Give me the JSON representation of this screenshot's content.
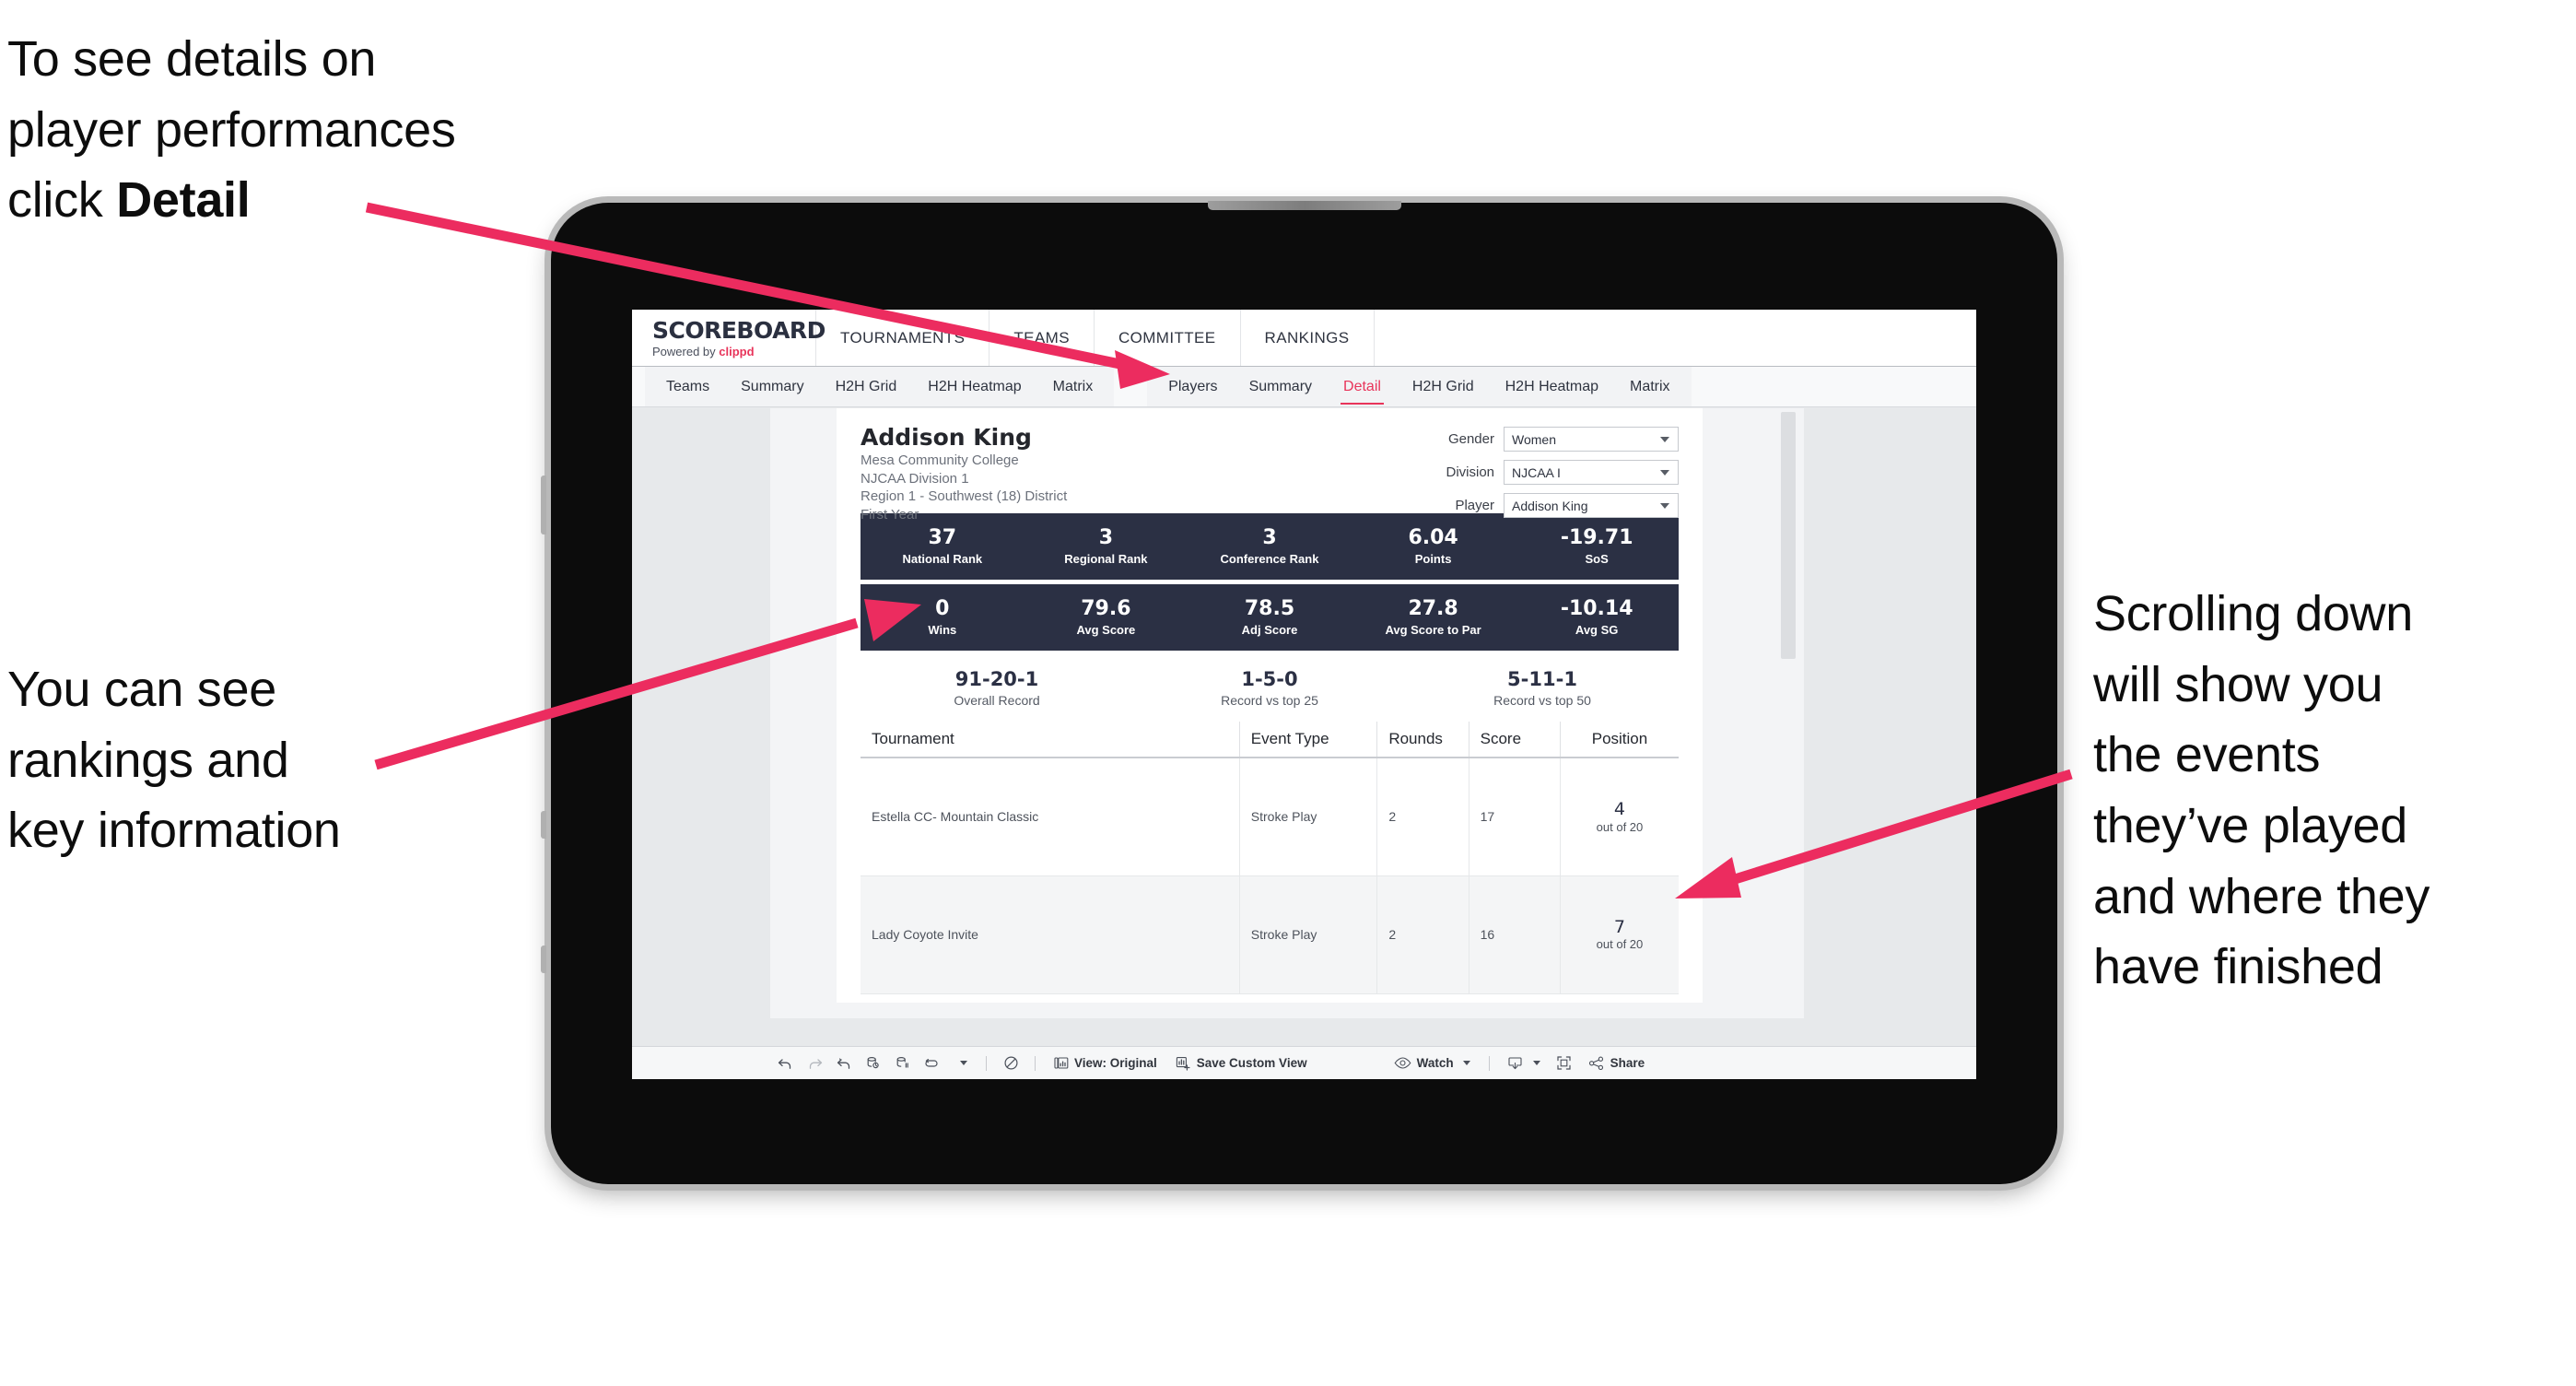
{
  "annotations": {
    "detail": {
      "line1": "To see details on",
      "line2": "player performances",
      "line3_prefix": "click ",
      "line3_bold": "Detail"
    },
    "rankings": {
      "line1": "You can see",
      "line2": "rankings and",
      "line3": "key information"
    },
    "scroll": {
      "line1": "Scrolling down",
      "line2": "will show you",
      "line3": "the events",
      "line4": "they’ve played",
      "line5": "and where they",
      "line6": "have finished"
    }
  },
  "brand": {
    "title": "SCOREBOARD",
    "powered_prefix": "Powered by ",
    "powered_name": "clippd"
  },
  "topnav": [
    {
      "label": "TOURNAMENTS"
    },
    {
      "label": "TEAMS"
    },
    {
      "label": "COMMITTEE"
    },
    {
      "label": "RANKINGS"
    }
  ],
  "tabs": {
    "teams_group": [
      {
        "label": "Teams",
        "active": false
      },
      {
        "label": "Summary",
        "active": false
      },
      {
        "label": "H2H Grid",
        "active": false
      },
      {
        "label": "H2H Heatmap",
        "active": false
      },
      {
        "label": "Matrix",
        "active": false
      }
    ],
    "players_group": [
      {
        "label": "Players",
        "active": false
      },
      {
        "label": "Summary",
        "active": false
      },
      {
        "label": "Detail",
        "active": true
      },
      {
        "label": "H2H Grid",
        "active": false
      },
      {
        "label": "H2H Heatmap",
        "active": false
      },
      {
        "label": "Matrix",
        "active": false
      }
    ]
  },
  "player": {
    "name": "Addison King",
    "school": "Mesa Community College",
    "division": "NJCAA Division 1",
    "region": "Region 1 - Southwest (18) District",
    "year": "First Year"
  },
  "filters": [
    {
      "label": "Gender",
      "value": "Women"
    },
    {
      "label": "Division",
      "value": "NJCAA I"
    },
    {
      "label": "Player",
      "value": "Addison King"
    }
  ],
  "stats_row1": [
    {
      "value": "37",
      "label": "National Rank"
    },
    {
      "value": "3",
      "label": "Regional Rank"
    },
    {
      "value": "3",
      "label": "Conference Rank"
    },
    {
      "value": "6.04",
      "label": "Points"
    },
    {
      "value": "-19.71",
      "label": "SoS"
    }
  ],
  "stats_row2": [
    {
      "value": "0",
      "label": "Wins"
    },
    {
      "value": "79.6",
      "label": "Avg Score"
    },
    {
      "value": "78.5",
      "label": "Adj Score"
    },
    {
      "value": "27.8",
      "label": "Avg Score to Par"
    },
    {
      "value": "-10.14",
      "label": "Avg SG"
    }
  ],
  "records": [
    {
      "value": "91-20-1",
      "label": "Overall Record"
    },
    {
      "value": "1-5-0",
      "label": "Record vs top 25"
    },
    {
      "value": "5-11-1",
      "label": "Record vs top 50"
    }
  ],
  "events_table": {
    "headers": [
      "Tournament",
      "Event Type",
      "Rounds",
      "Score",
      "Position"
    ],
    "rows": [
      {
        "tournament": "Estella CC- Mountain Classic",
        "event_type": "Stroke Play",
        "rounds": "2",
        "score": "17",
        "position_num": "4",
        "position_out": "out of 20"
      },
      {
        "tournament": "Lady Coyote Invite",
        "event_type": "Stroke Play",
        "rounds": "2",
        "score": "16",
        "position_num": "7",
        "position_out": "out of 20"
      }
    ]
  },
  "toolbar": {
    "view_label": "View: Original",
    "save_label": "Save Custom View",
    "watch_label": "Watch",
    "share_label": "Share"
  },
  "colors": {
    "accent_pink": "#e8345a",
    "stat_bar_navy": "#2b3044",
    "canvas_grey": "#e7e9eb"
  }
}
